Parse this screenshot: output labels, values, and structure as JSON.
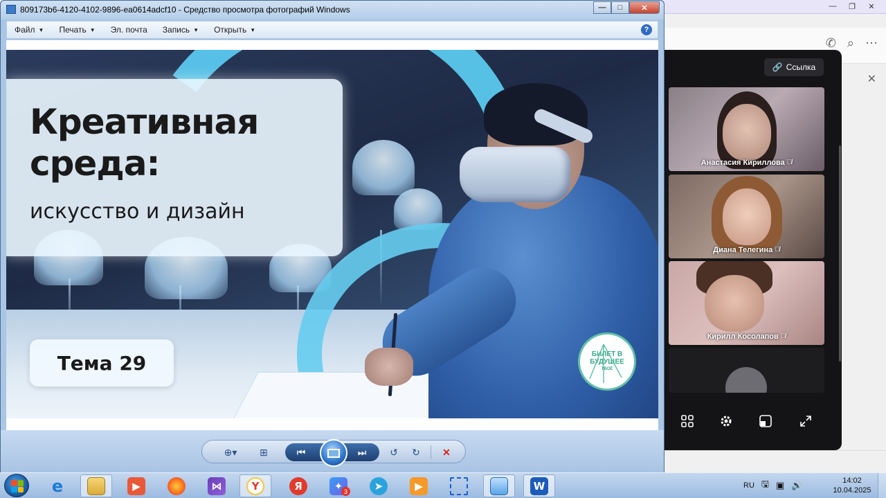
{
  "viewer": {
    "title": "809173b6-4120-4102-9896-ea0614adcf10 - Средство просмотра фотографий Windows",
    "menu": [
      {
        "label": "Файл",
        "arrow": "▼"
      },
      {
        "label": "Печать",
        "arrow": "▼"
      },
      {
        "label": "Эл. почта",
        "arrow": ""
      },
      {
        "label": "Запись",
        "arrow": "▼"
      },
      {
        "label": "Открыть",
        "arrow": "▼"
      }
    ],
    "help": "?",
    "window_buttons": {
      "minimize": "—",
      "maximize": "□",
      "close": "✕"
    }
  },
  "slide": {
    "title": "Креативная\nсреда:",
    "subtitle": "искусство и дизайн",
    "theme": "Тема 29",
    "logo_line1": "БИЛЕТ В",
    "logo_line2": "БУДУЩЕЕ",
    "logo_small": "ТВОЁ"
  },
  "call": {
    "link_label": "Ссылка",
    "participants": [
      {
        "name": "Анастасия Кириллова",
        "muted": true
      },
      {
        "name": "Диана Телегина",
        "muted": true
      },
      {
        "name": "Кирилл Косолапов",
        "muted": true
      }
    ]
  },
  "taskbar": {
    "lang": "RU",
    "time": "14:02",
    "date": "10.04.2025",
    "messenger_badge": "3"
  },
  "colors": {
    "accent_blue": "#5ac8ee",
    "call_bg": "#141416",
    "logo_green": "#3aa88a"
  }
}
